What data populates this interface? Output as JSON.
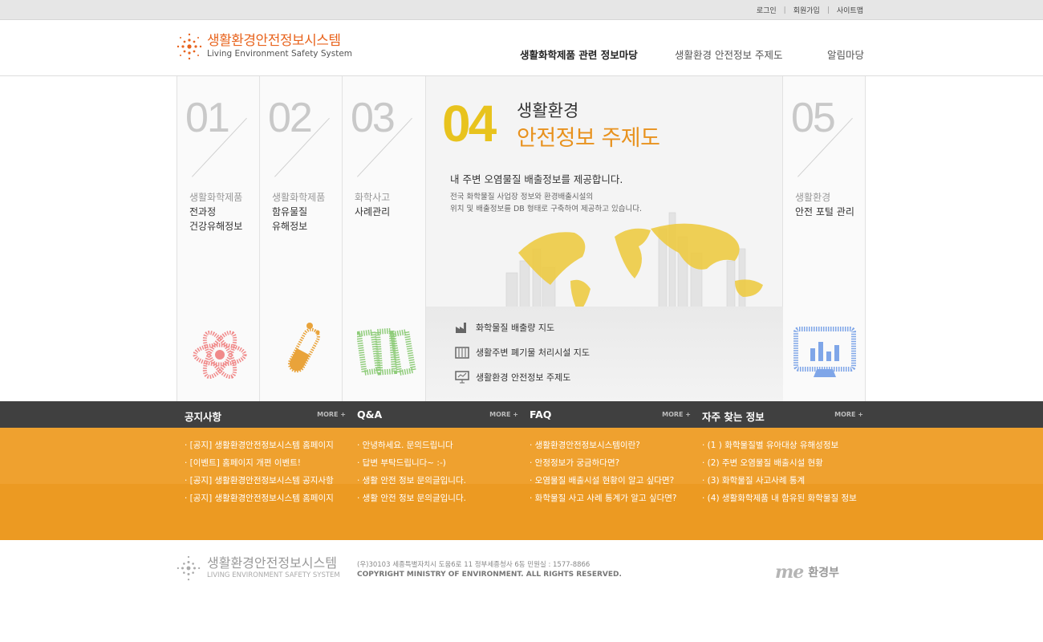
{
  "util_links": [
    "로그인",
    "회원가입",
    "사이트맵"
  ],
  "logo": {
    "ko": "생활환경안전정보시스템",
    "en": "Living Environment Safety System"
  },
  "gnb": [
    "생활화학제품 관련 정보마당",
    "생활환경 안전정보 주제도",
    "알림마당"
  ],
  "columns": [
    {
      "num": "01",
      "t1": "생활화학제품",
      "t2a": "전과정",
      "t2b": "건강유해정보",
      "icon": "atom-icon"
    },
    {
      "num": "02",
      "t1": "생활화학제품",
      "t2a": "함유물질",
      "t2b": "유해정보",
      "icon": "test-tube-icon"
    },
    {
      "num": "03",
      "t1": "화학사고",
      "t2a": "사례관리",
      "t2b": "",
      "icon": "documents-icon"
    },
    {
      "num": "05",
      "t1": "생활환경",
      "t2a": "안전 포털 관리",
      "t2b": "",
      "icon": "monitor-chart-icon"
    }
  ],
  "featured": {
    "num": "04",
    "title1": "생활환경",
    "title2": "안전정보 주제도",
    "desc1": "내 주변 오염물질 배출정보를 제공합니다.",
    "desc2a": "전국 화학물질 사업장 정보와 환경배출시설의",
    "desc2b": "위치 및 배출정보를 DB 형태로 구축하여 제공하고 있습니다.",
    "links": [
      "화학물질 배출량 지도",
      "생활주변 폐기물 처리시설 지도",
      "생활환경 안전정보 주제도"
    ]
  },
  "boards": [
    {
      "title": "공지사항",
      "more": "MORE +",
      "items": [
        "· [공지] 생활환경안전정보시스템 홈페이지",
        "· [이벤트] 홈페이지 개편 이벤트!",
        "· [공지] 생활환경안전정보시스템 공지사항",
        "· [공지] 생활환경안전정보시스템 홈페이지"
      ]
    },
    {
      "title": "Q&A",
      "more": "MORE +",
      "items": [
        "· 안녕하세요. 문의드립니다",
        "· 답변 부탁드립니다~ :-)",
        "· 생활 안전 정보 문의글입니다.",
        "· 생활 안전 정보 문의글입니다."
      ]
    },
    {
      "title": "FAQ",
      "more": "MORE +",
      "items": [
        "· 생활환경안전정보시스템이란?",
        "· 안정정보가 궁금하다면?",
        "· 오염물질 배출시설 현황이 알고 싶다면?",
        "· 화학물질 사고 사례 통계가 알고 싶다면?"
      ]
    },
    {
      "title": "자주 찾는 정보",
      "more": "MORE +",
      "items": [
        "· (1 ) 화학물질별 유아대상 유해성정보",
        "· (2) 주변 오염물질 배출시설 현황",
        "· (3) 화학물질 사고사례 통계",
        "· (4) 생활화학제품 내 함유된 화학물질 정보"
      ]
    }
  ],
  "footer": {
    "logo_ko": "생활환경안전정보시스템",
    "logo_en": "LIVING ENVIRONMENT SAFETY SYSTEM",
    "address": "(우)30103 세종특별자치시 도움6로 11 정부세종청사 6동 민원실 : 1577-8866",
    "copyright": "COPYRIGHT MINISTRY OF ENVIRONMENT. ALL RIGHTS RESERVED.",
    "gov_en": "me",
    "gov_ko": "환경부"
  },
  "colors": {
    "accent_orange": "#e8641e",
    "featured_yellow": "#e8c31e",
    "board_bg": "#efa12f",
    "board_head": "#404040"
  }
}
